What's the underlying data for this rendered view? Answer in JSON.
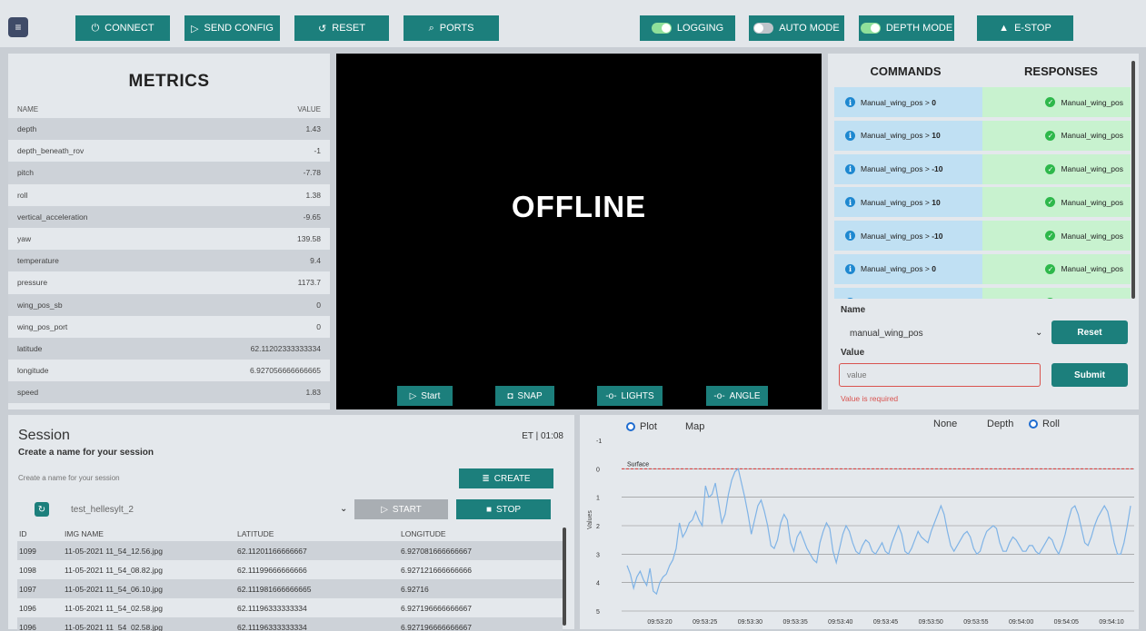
{
  "toolbar": {
    "menu_icon": "menu-icon",
    "connect": "CONNECT",
    "send_config": "SEND CONFIG",
    "reset": "RESET",
    "ports": "PORTS",
    "logging": "LOGGING",
    "auto_mode": "AUTO MODE",
    "depth_mode": "DEPTH MODE",
    "estop": "E-STOP",
    "toggles": {
      "logging": true,
      "auto_mode": false,
      "depth_mode": true
    },
    "accent_color": "#1c7f7c"
  },
  "metrics": {
    "title": "METRICS",
    "col_name": "NAME",
    "col_value": "VALUE",
    "rows": [
      {
        "name": "depth",
        "value": "1.43"
      },
      {
        "name": "depth_beneath_rov",
        "value": "-1"
      },
      {
        "name": "pitch",
        "value": "-7.78"
      },
      {
        "name": "roll",
        "value": "1.38"
      },
      {
        "name": "vertical_acceleration",
        "value": "-9.65"
      },
      {
        "name": "yaw",
        "value": "139.58"
      },
      {
        "name": "temperature",
        "value": "9.4"
      },
      {
        "name": "pressure",
        "value": "1173.7"
      },
      {
        "name": "wing_pos_sb",
        "value": "0"
      },
      {
        "name": "wing_pos_port",
        "value": "0"
      },
      {
        "name": "latitude",
        "value": "62.11202333333334"
      },
      {
        "name": "longitude",
        "value": "6.927056666666665"
      },
      {
        "name": "speed",
        "value": "1.83"
      }
    ]
  },
  "video": {
    "status": "OFFLINE",
    "start": "Start",
    "snap": "SNAP",
    "lights": "LIGHTS",
    "angle": "ANGLE"
  },
  "commands": {
    "commands_header": "COMMANDS",
    "responses_header": "RESPONSES",
    "rows": [
      {
        "cmd": "Manual_wing_pos",
        "val": "0",
        "resp": "Manual_wing_pos"
      },
      {
        "cmd": "Manual_wing_pos",
        "val": "10",
        "resp": "Manual_wing_pos"
      },
      {
        "cmd": "Manual_wing_pos",
        "val": "-10",
        "resp": "Manual_wing_pos"
      },
      {
        "cmd": "Manual_wing_pos",
        "val": "10",
        "resp": "Manual_wing_pos"
      },
      {
        "cmd": "Manual_wing_pos",
        "val": "-10",
        "resp": "Manual_wing_pos"
      },
      {
        "cmd": "Manual_wing_pos",
        "val": "0",
        "resp": "Manual_wing_pos"
      }
    ],
    "name_label": "Name",
    "name_value": "manual_wing_pos",
    "reset": "Reset",
    "value_label": "Value",
    "value_placeholder": "value",
    "submit": "Submit",
    "error": "Value is required"
  },
  "session": {
    "title": "Session",
    "subtitle": "Create a name for your session",
    "elapsed": "ET | 01:08",
    "name_placeholder": "Create a name for your session",
    "create": "CREATE",
    "selected": "test_hellesylt_2",
    "start": "START",
    "stop": "STOP",
    "columns": [
      "ID",
      "IMG NAME",
      "LATITUDE",
      "LONGITUDE"
    ],
    "rows": [
      [
        "1099",
        "11-05-2021 11_54_12.56.jpg",
        "62.11201166666667",
        "6.927081666666667"
      ],
      [
        "1098",
        "11-05-2021 11_54_08.82.jpg",
        "62.11199666666666",
        "6.927121666666666"
      ],
      [
        "1097",
        "11-05-2021 11_54_06.10.jpg",
        "62.111981666666665",
        "6.92716"
      ],
      [
        "1096",
        "11-05-2021 11_54_02.58.jpg",
        "62.11196333333334",
        "6.927196666666667"
      ]
    ]
  },
  "chart_panel": {
    "view_options": [
      "Plot",
      "Map"
    ],
    "view_selected": "Plot",
    "series_options": [
      "None",
      "Depth",
      "Roll"
    ],
    "series_selected": "Roll"
  },
  "chart_data": {
    "type": "line",
    "title": "",
    "xlabel": "",
    "ylabel": "Values",
    "y_inverted": true,
    "ylim": [
      -1,
      5
    ],
    "y_ticks": [
      "-1",
      "0",
      "1",
      "2",
      "3",
      "4",
      "5"
    ],
    "x_ticks": [
      "09:53:20",
      "09:53:25",
      "09:53:30",
      "09:53:35",
      "09:53:40",
      "09:53:45",
      "09:53:50",
      "09:53:55",
      "09:54:00",
      "09:54:05",
      "09:54:10"
    ],
    "annotation": "Surface",
    "surface_value": 0,
    "line_color": "#7fb3e6",
    "surface_color": "#d63333",
    "series": [
      {
        "values": [
          3.4,
          3.7,
          4.2,
          3.8,
          3.6,
          3.9,
          4.1,
          3.5,
          4.3,
          4.4,
          4.0,
          3.8,
          3.7,
          3.4,
          3.2,
          2.8,
          1.9,
          2.4,
          2.2,
          1.9,
          1.8,
          1.5,
          1.8,
          2.0,
          0.6,
          1.0,
          0.9,
          0.5,
          1.2,
          1.9,
          1.6,
          0.9,
          0.4,
          0.1,
          0.0,
          0.5,
          1.0,
          1.6,
          2.3,
          1.8,
          1.3,
          1.1,
          1.5,
          2.0,
          2.7,
          2.8,
          2.5,
          1.9,
          1.6,
          1.8,
          2.6,
          2.9,
          2.4,
          2.2,
          2.5,
          2.8,
          3.0,
          3.2,
          3.3,
          2.6,
          2.2,
          1.9,
          2.1,
          2.9,
          3.3,
          2.8,
          2.3,
          2.0,
          2.2,
          2.6,
          2.9,
          3.0,
          2.7,
          2.5,
          2.6,
          2.9,
          3.0,
          2.8,
          2.6,
          2.9,
          3.0,
          2.6,
          2.3,
          2.0,
          2.3,
          2.9,
          3.0,
          2.8,
          2.5,
          2.2,
          2.4,
          2.5,
          2.6,
          2.2,
          1.9,
          1.6,
          1.3,
          1.6,
          2.2,
          2.7,
          2.9,
          2.7,
          2.5,
          2.3,
          2.2,
          2.4,
          2.8,
          3.0,
          2.9,
          2.5,
          2.2,
          2.1,
          2.0,
          2.1,
          2.6,
          2.9,
          2.9,
          2.6,
          2.4,
          2.5,
          2.7,
          2.9,
          2.9,
          2.7,
          2.7,
          2.9,
          3.0,
          2.8,
          2.6,
          2.4,
          2.5,
          2.8,
          3.0,
          2.7,
          2.3,
          1.8,
          1.4,
          1.3,
          1.6,
          2.1,
          2.6,
          2.7,
          2.4,
          2.0,
          1.7,
          1.5,
          1.3,
          1.5,
          2.0,
          2.6,
          3.0,
          3.0,
          2.6,
          2.0,
          1.3
        ]
      }
    ]
  }
}
